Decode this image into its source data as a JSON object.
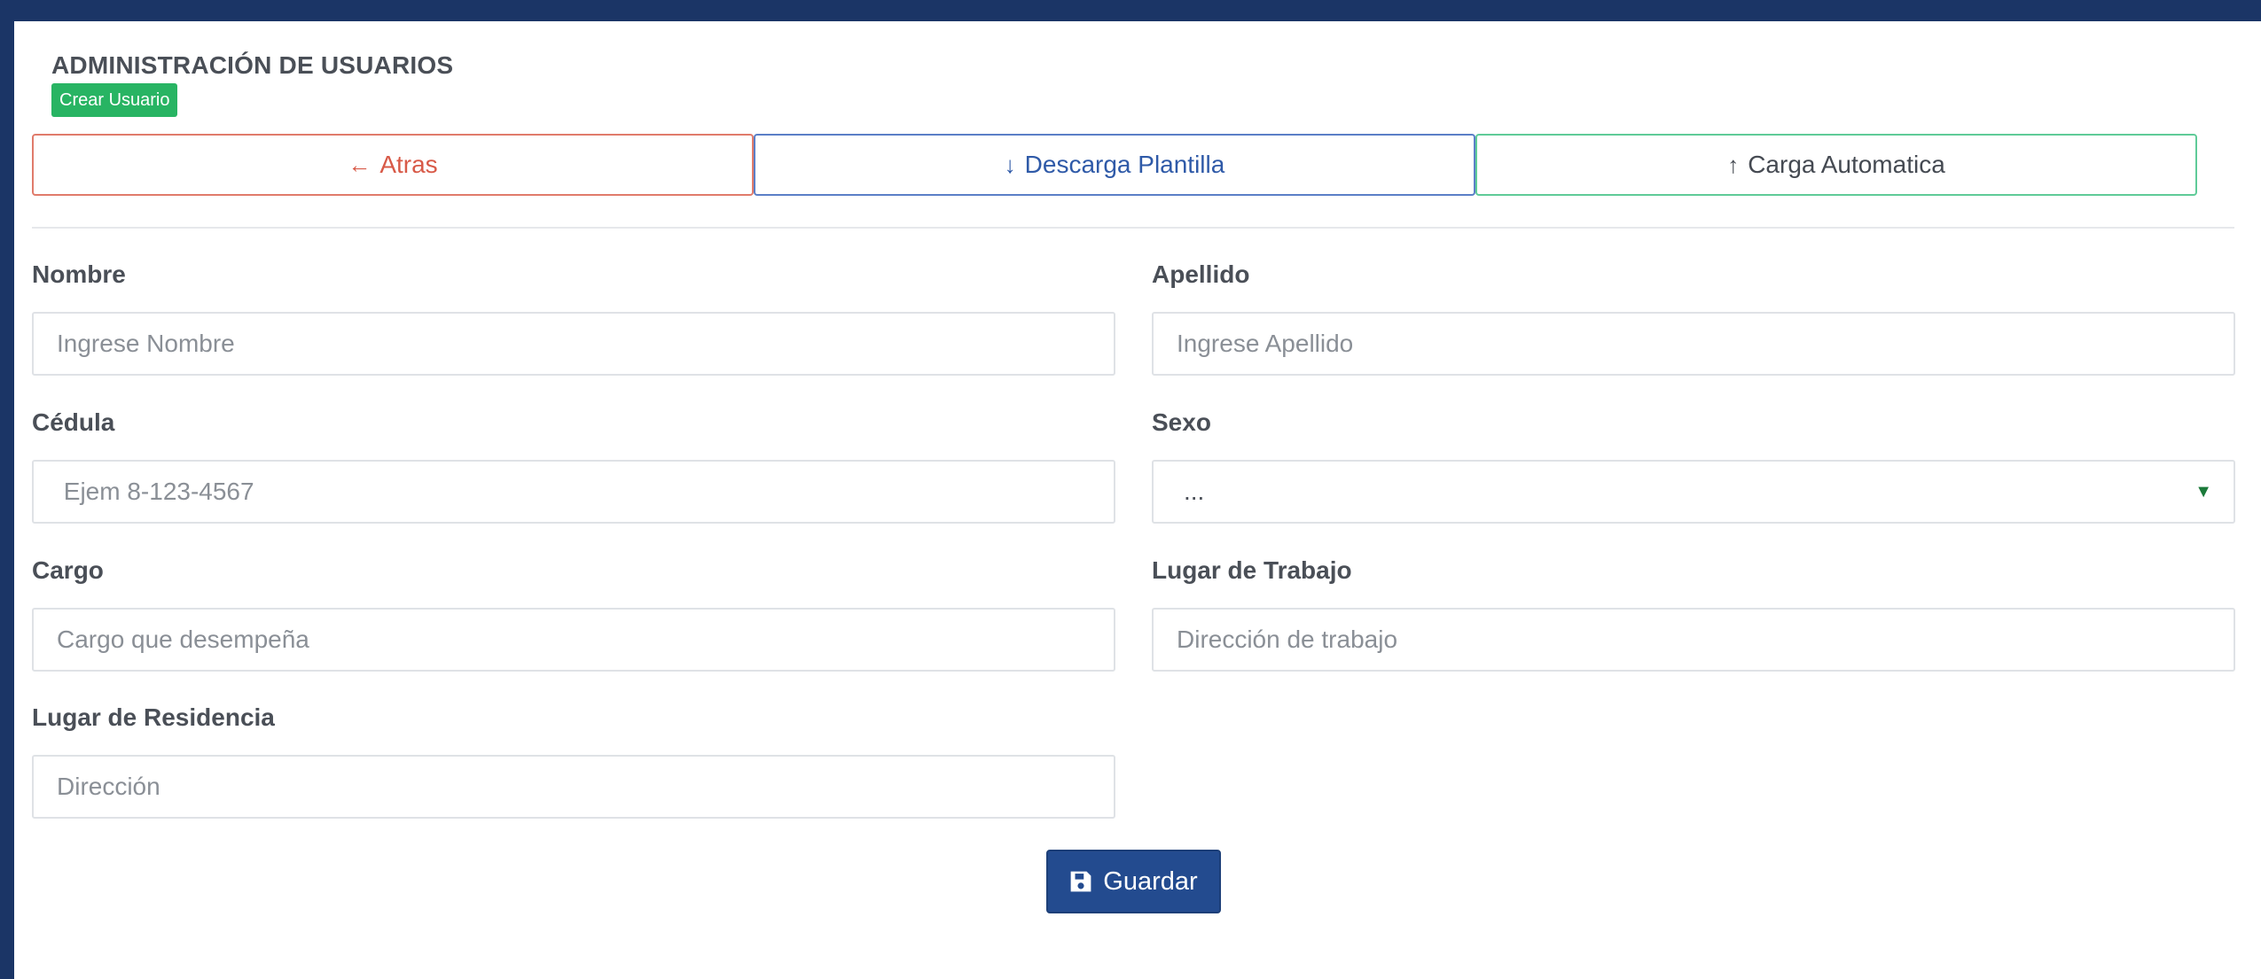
{
  "header": {
    "title": "ADMINISTRACIÓN DE USUARIOS",
    "badge": "Crear Usuario"
  },
  "actions": {
    "back": {
      "icon": "arrow-left-icon",
      "glyph": "←",
      "label": "Atras"
    },
    "download": {
      "icon": "arrow-down-icon",
      "glyph": "↓",
      "label": "Descarga Plantilla"
    },
    "upload": {
      "icon": "arrow-up-icon",
      "glyph": "↑",
      "label": "Carga Automatica"
    }
  },
  "form": {
    "nombre": {
      "label": "Nombre",
      "placeholder": "Ingrese Nombre",
      "value": ""
    },
    "apellido": {
      "label": "Apellido",
      "placeholder": "Ingrese Apellido",
      "value": ""
    },
    "cedula": {
      "label": "Cédula",
      "placeholder": " Ejem 8-123-4567",
      "value": ""
    },
    "sexo": {
      "label": "Sexo",
      "selected": "..."
    },
    "cargo": {
      "label": "Cargo",
      "placeholder": "Cargo que desempeña",
      "value": ""
    },
    "lugar_trabajo": {
      "label": "Lugar de Trabajo",
      "placeholder": "Dirección de trabajo",
      "value": ""
    },
    "lugar_residencia": {
      "label": "Lugar de Residencia",
      "placeholder": "Dirección",
      "value": ""
    }
  },
  "save": {
    "icon": "floppy-disk-icon",
    "label": "Guardar"
  },
  "colors": {
    "frame": "#1b3566",
    "badge": "#28b463",
    "back": "#d85a48",
    "download": "#2f5aa8",
    "upload_border": "#5fcb98",
    "save": "#234b8f"
  }
}
